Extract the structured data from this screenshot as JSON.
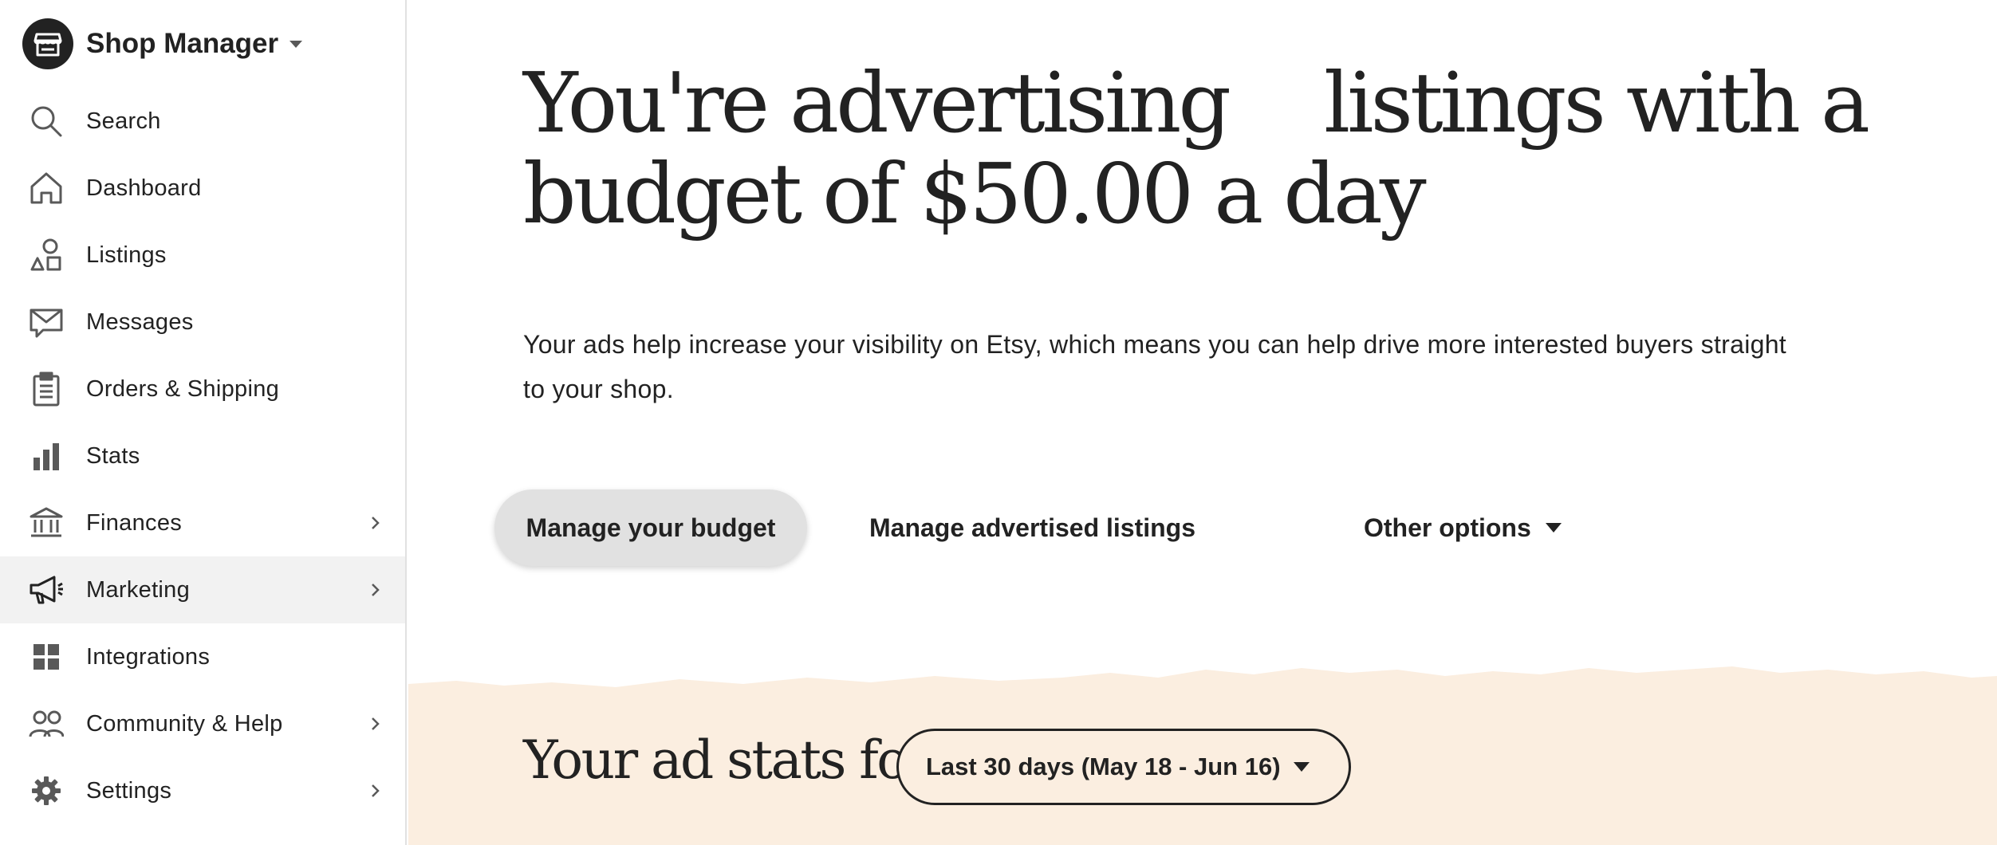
{
  "sidebar": {
    "shop_title": "Shop Manager",
    "logo_icon": "store-icon",
    "items": [
      {
        "label": "Search",
        "icon": "search-icon",
        "has_chevron": false
      },
      {
        "label": "Dashboard",
        "icon": "home-icon",
        "has_chevron": false
      },
      {
        "label": "Listings",
        "icon": "shapes-icon",
        "has_chevron": false
      },
      {
        "label": "Messages",
        "icon": "envelope-icon",
        "has_chevron": false
      },
      {
        "label": "Orders & Shipping",
        "icon": "clipboard-icon",
        "has_chevron": false
      },
      {
        "label": "Stats",
        "icon": "bar-chart-icon",
        "has_chevron": false
      },
      {
        "label": "Finances",
        "icon": "bank-icon",
        "has_chevron": true
      },
      {
        "label": "Marketing",
        "icon": "megaphone-icon",
        "has_chevron": true,
        "active": true
      },
      {
        "label": "Integrations",
        "icon": "grid-icon",
        "has_chevron": false
      },
      {
        "label": "Community & Help",
        "icon": "people-icon",
        "has_chevron": true
      },
      {
        "label": "Settings",
        "icon": "gear-icon",
        "has_chevron": true
      }
    ]
  },
  "main": {
    "headline_part1": "You're advertising",
    "headline_part2": "listings with a budget of $50.00 a day",
    "description": "Your ads help increase your visibility on Etsy, which means you can help drive more interested buyers straight to your shop.",
    "actions": {
      "manage_budget": "Manage your budget",
      "manage_listings": "Manage advertised listings",
      "other_options": "Other options"
    },
    "stats": {
      "heading": "Your ad stats for",
      "date_range": "Last 30 days (May 18 - Jun 16)"
    }
  },
  "colors": {
    "text": "#222222",
    "sidebar_active_bg": "#f2f2f2",
    "primary_button_bg": "#e1e1e1",
    "stats_band_bg": "#fbeee0"
  }
}
